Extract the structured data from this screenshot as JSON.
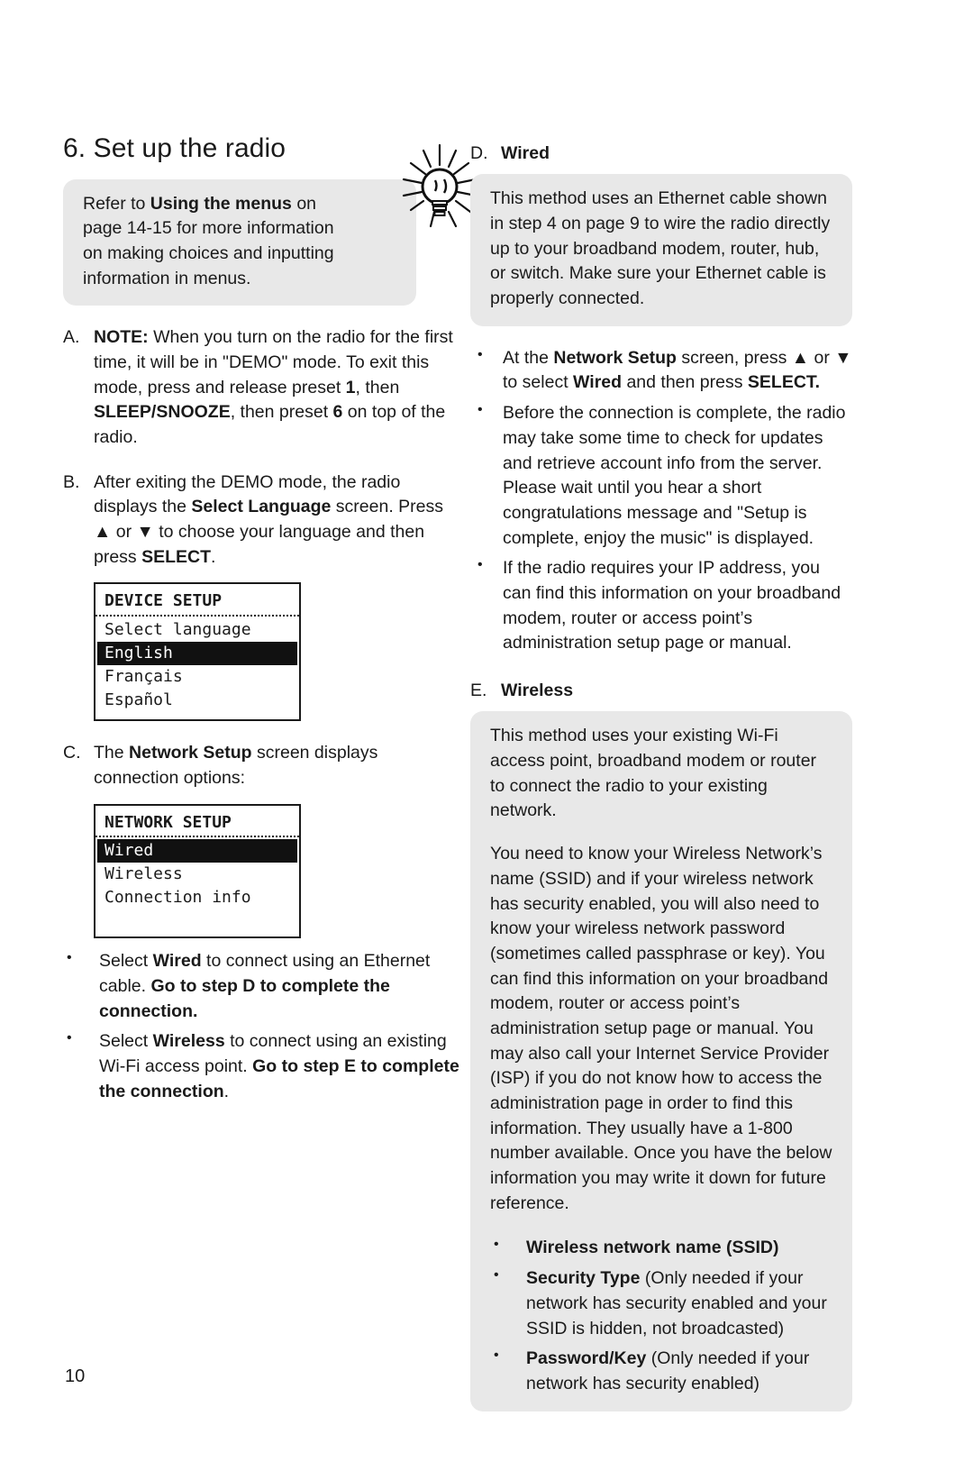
{
  "page": {
    "title": "6. Set up the radio",
    "folio": "10"
  },
  "tip": {
    "icon": "lightbulb-icon",
    "text_before": "Refer to ",
    "text_bold": "Using the menus",
    "text_after": " on page 14-15 for more information on making choices and inputting information in menus."
  },
  "items": {
    "a": {
      "letter": "A.",
      "bold_lead": "NOTE:",
      "text": " When you turn on the radio for the first time, it will be in \"DEMO\" mode. To exit this mode, press and release preset ",
      "b1": "1",
      "t2": ", then ",
      "b2": "SLEEP/SNOOZE",
      "t3": ", then preset ",
      "b3": "6",
      "t4": " on top of the radio."
    },
    "b": {
      "letter": "B.",
      "t1": "After exiting the DEMO mode, the radio displays the ",
      "b1": "Select Language",
      "t2": " screen. Press ▲ or ▼ to choose your language and then press ",
      "b2": "SELECT",
      "t3": "."
    },
    "c": {
      "letter": "C.",
      "t1": "The ",
      "b1": "Network Setup",
      "t2": " screen displays connection options:"
    },
    "d": {
      "letter": "D.",
      "label": "Wired"
    },
    "e": {
      "letter": "E.",
      "label": "Wireless"
    }
  },
  "lcd_language": {
    "title": "DEVICE SETUP",
    "rows": [
      {
        "text": "Select language",
        "selected": false
      },
      {
        "text": "English",
        "selected": true
      },
      {
        "text": "Français",
        "selected": false
      },
      {
        "text": "Español",
        "selected": false
      }
    ]
  },
  "lcd_network": {
    "title": "NETWORK SETUP",
    "rows": [
      {
        "text": "Wired",
        "selected": true
      },
      {
        "text": "Wireless",
        "selected": false
      },
      {
        "text": "Connection info",
        "selected": false
      }
    ]
  },
  "c_bullets": [
    {
      "t1": "Select ",
      "b1": "Wired",
      "t2": " to connect using an Ethernet cable. ",
      "b2": "Go to step D to complete the connection.",
      "t3": ""
    },
    {
      "t1": "Select ",
      "b1": "Wireless",
      "t2": " to connect using an existing Wi-Fi access point. ",
      "b2": "Go to step E to complete the connection",
      "t3": "."
    }
  ],
  "wired": {
    "callout": "This method uses an Ethernet cable shown in step 4 on page 9 to wire the radio directly up to your broadband modem, router, hub, or switch. Make sure your Ethernet cable is properly connected.",
    "bullets": [
      {
        "t1": "At the ",
        "b1": "Network Setup",
        "t2": " screen, press ▲ or ▼ to select ",
        "b2": "Wired",
        "t3": " and then press ",
        "b3": "SELECT.",
        "t4": ""
      },
      {
        "t1": "Before the connection is complete, the radio may take some time to check for updates and retrieve account info from the server. Please wait until you hear a short congratulations message and \"Setup is complete, enjoy the music\" is displayed.",
        "b1": "",
        "t2": "",
        "b2": "",
        "t3": "",
        "b3": "",
        "t4": ""
      },
      {
        "t1": "If the radio requires your IP address, you can find this information on your broadband modem, router or access point’s administration setup page or manual.",
        "b1": "",
        "t2": "",
        "b2": "",
        "t3": "",
        "b3": "",
        "t4": ""
      }
    ]
  },
  "wireless": {
    "callout_p1": "This method uses your existing Wi-Fi access point, broadband modem or router to connect the radio to your existing network.",
    "callout_p2": "You need to know your Wireless Network’s name (SSID) and if your wireless network has security enabled, you will also need to know your wireless network password (sometimes called passphrase or key). You can find this information on your broadband modem, router or access point’s administration setup page or manual.  You may also call your Internet Service Provider (ISP) if you do not know how to access the administration page in order to find this information. They usually have a 1-800 number available. Once you have the below information you may write it down for future reference.",
    "bullets": [
      {
        "bold": "Wireless network name (SSID)",
        "rest": ""
      },
      {
        "bold": "Security Type",
        "rest": " (Only needed if your network has security enabled and your SSID is hidden, not broadcasted)"
      },
      {
        "bold": "Password/Key",
        "rest": " (Only needed if your network has security enabled)"
      }
    ]
  },
  "colors": {
    "callout_bg": "#e8e8e8",
    "text": "#1a1a1a",
    "lcd_highlight": "#111111"
  }
}
